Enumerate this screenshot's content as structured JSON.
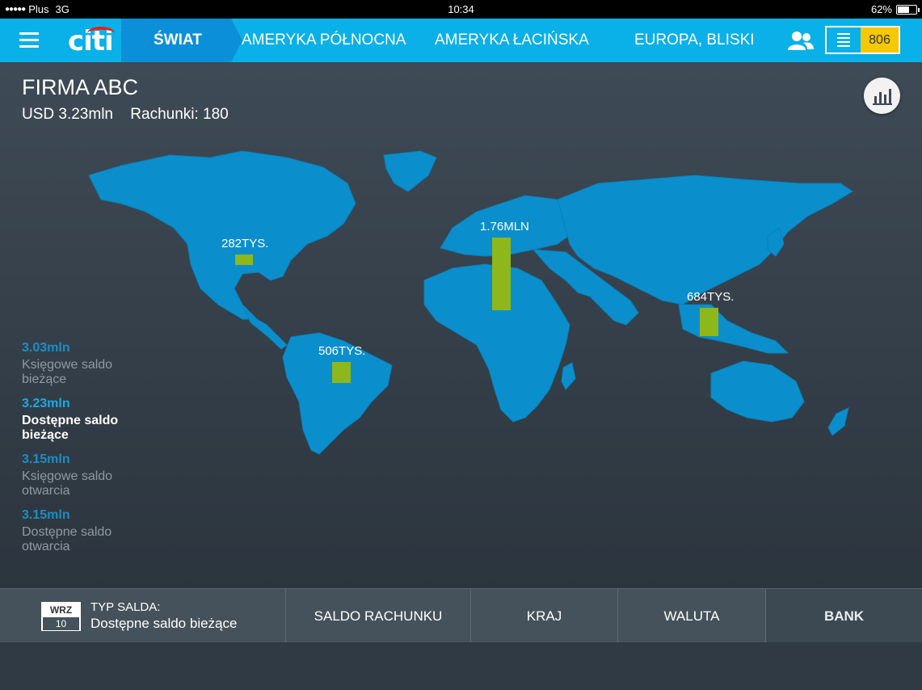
{
  "status": {
    "carrier": "Plus",
    "network": "3G",
    "time": "10:34",
    "battery": "62%",
    "battery_level": 0.62
  },
  "nav": {
    "logo": "citi",
    "active_tab": "ŚWIAT",
    "tabs": [
      "AMERYKA PÓŁNOCNA",
      "AMERYKA ŁACIŃSKA",
      "EUROPA, BLISKI"
    ],
    "counter": "806"
  },
  "company": {
    "name": "FIRMA ABC",
    "amount": "USD 3.23mln",
    "accounts": "Rachunki: 180"
  },
  "map": {
    "regions": [
      {
        "label": "282TYS.",
        "value": 282000
      },
      {
        "label": "1.76MLN",
        "value": 1760000
      },
      {
        "label": "684TYS.",
        "value": 684000
      },
      {
        "label": "506TYS.",
        "value": 506000
      }
    ]
  },
  "balances": [
    {
      "amount": "3.03mln",
      "line1": "Księgowe saldo",
      "line2": "bieżące"
    },
    {
      "amount": "3.23mln",
      "line1": "Dostępne saldo",
      "line2": "bieżące",
      "active": true
    },
    {
      "amount": "3.15mln",
      "line1": "Księgowe saldo",
      "line2": "otwarcia"
    },
    {
      "amount": "3.15mln",
      "line1": "Dostępne saldo",
      "line2": "otwarcia"
    }
  ],
  "bottom": {
    "cal_month": "WRZ",
    "cal_day": "10",
    "type_label": "TYP SALDA:",
    "type_value": "Dostępne saldo bieżące",
    "tabs": [
      "SALDO RACHUNKU",
      "KRAJ",
      "WALUTA",
      "BANK"
    ]
  },
  "colors": {
    "nav_bg": "#0ab0e8",
    "nav_active": "#0b8fd8",
    "map_land": "#0a8fcc",
    "bar": "#8db71a",
    "counter_bg": "#f5c800"
  },
  "icons": [
    "hamburger-icon",
    "users-icon",
    "list-icon",
    "bar-chart-icon"
  ]
}
